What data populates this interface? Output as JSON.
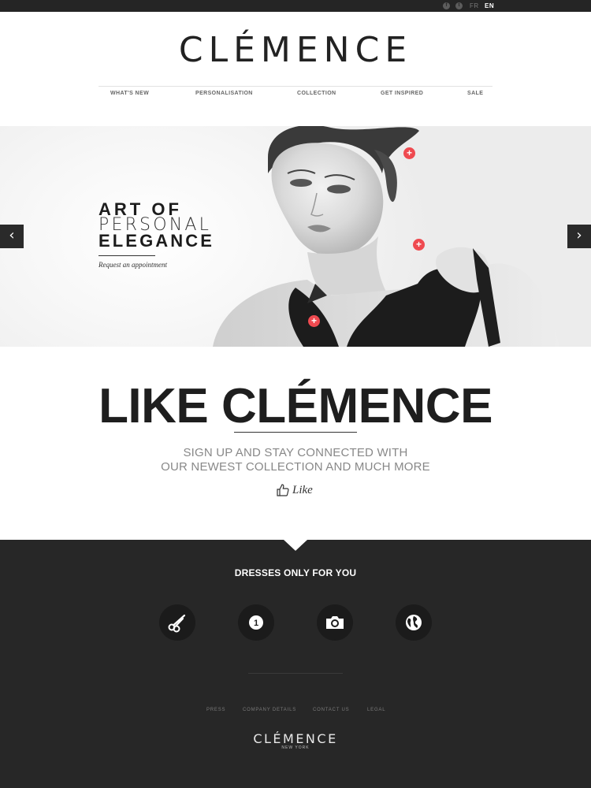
{
  "topbar": {
    "social": [
      {
        "name": "facebook-icon",
        "glyph": "f"
      },
      {
        "name": "twitter-icon",
        "glyph": "t"
      }
    ],
    "languages": [
      "FR",
      "EN"
    ],
    "active_language": "EN"
  },
  "header": {
    "logo": "CLÉMENCE",
    "nav": [
      "WHAT'S NEW",
      "PERSONALISATION",
      "COLLECTION",
      "GET INSPIRED",
      "SALE"
    ]
  },
  "hero": {
    "title_line1": "ART OF",
    "title_line2": "PERSONAL",
    "title_line3": "ELEGANCE",
    "cta": "Request an appointment",
    "prev_arrow": "‹",
    "next_arrow": "›",
    "hotspot_glyph": "+"
  },
  "like_section": {
    "title": "LIKE CLÉMENCE",
    "subtitle_line1": "SIGN UP AND STAY CONNECTED WITH",
    "subtitle_line2": "OUR NEWEST COLLECTION AND MUCH MORE",
    "like_label": "Like"
  },
  "features": {
    "heading": "DRESSES ONLY FOR YOU",
    "icons": [
      "scissors-icon",
      "number-one-icon",
      "camera-icon",
      "globe-icon"
    ],
    "badge_number": "1"
  },
  "footer": {
    "links": [
      "PRESS",
      "COMPANY DETAILS",
      "CONTACT US",
      "LEGAL"
    ],
    "logo": "CLÉMENCE",
    "location": "NEW YORK"
  },
  "colors": {
    "dark": "#272727",
    "accent": "#ef4a50",
    "topbar": "#252525"
  }
}
